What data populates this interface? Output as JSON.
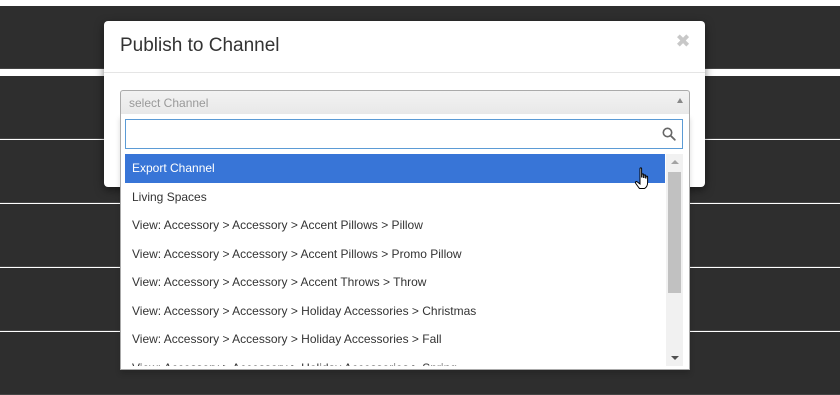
{
  "modal": {
    "title": "Publish to Channel",
    "close_icon": "close-icon"
  },
  "select": {
    "placeholder": "select Channel",
    "search_value": "",
    "search_icon": "search-icon"
  },
  "options": [
    {
      "label": "Export Channel",
      "highlighted": true
    },
    {
      "label": "Living Spaces"
    },
    {
      "label": "View: Accessory > Accessory > Accent Pillows > Pillow"
    },
    {
      "label": "View: Accessory > Accessory > Accent Pillows > Promo Pillow"
    },
    {
      "label": "View: Accessory > Accessory > Accent Throws > Throw"
    },
    {
      "label": "View: Accessory > Accessory > Holiday Accessories > Christmas"
    },
    {
      "label": "View: Accessory > Accessory > Holiday Accessories > Fall"
    },
    {
      "label": "View: Accessory > Accessory > Holiday Accessories > Spring"
    }
  ],
  "colors": {
    "highlight": "#3875d7",
    "search_border": "#5b9bd5"
  }
}
